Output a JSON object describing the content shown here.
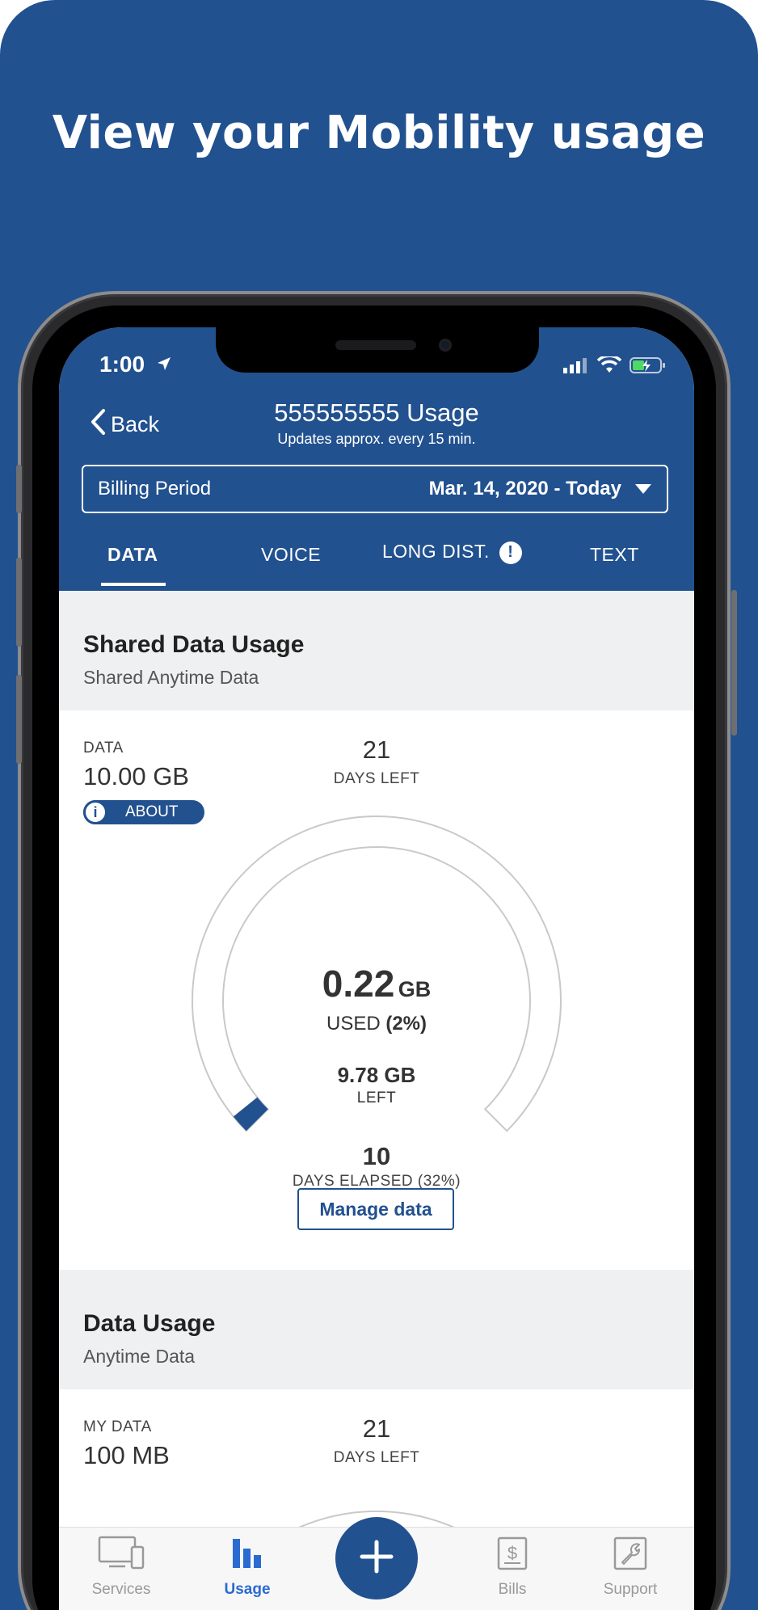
{
  "headline": "View your Mobility usage",
  "status_bar": {
    "time": "1:00"
  },
  "header": {
    "back_label": "Back",
    "title": "555555555 Usage",
    "subtitle": "Updates approx. every 15 min."
  },
  "billing": {
    "label": "Billing Period",
    "value": "Mar. 14, 2020 - Today"
  },
  "tabs": [
    {
      "label": "DATA"
    },
    {
      "label": "VOICE"
    },
    {
      "label": "LONG DIST."
    },
    {
      "label": "TEXT"
    }
  ],
  "shared": {
    "title": "Shared Data Usage",
    "subtitle": "Shared Anytime Data",
    "data_caption": "DATA",
    "data_value": "10.00 GB",
    "about_label": "ABOUT",
    "days_left_value": "21",
    "days_left_label": "DAYS LEFT",
    "used_value": "0.22",
    "used_unit": "GB",
    "used_label": "USED",
    "used_percent": "(2%)",
    "left_value": "9.78 GB",
    "left_label": "LEFT",
    "elapsed_value": "10",
    "elapsed_label": "DAYS ELAPSED (32%)",
    "manage_label": "Manage data",
    "used_fraction": 0.022
  },
  "data_usage": {
    "title": "Data Usage",
    "subtitle": "Anytime Data",
    "data_caption": "MY DATA",
    "data_value": "100 MB",
    "days_left_value": "21",
    "days_left_label": "DAYS LEFT"
  },
  "bottom_nav": [
    {
      "label": "Services",
      "icon": "devices-icon"
    },
    {
      "label": "Usage",
      "icon": "bar-chart-icon"
    },
    {
      "label": "",
      "icon": "plus-icon"
    },
    {
      "label": "Bills",
      "icon": "bill-icon"
    },
    {
      "label": "Support",
      "icon": "wrench-icon"
    }
  ],
  "colors": {
    "brand": "#22518f",
    "active_nav": "#2a6bd1",
    "section_bg": "#eff0f1"
  }
}
